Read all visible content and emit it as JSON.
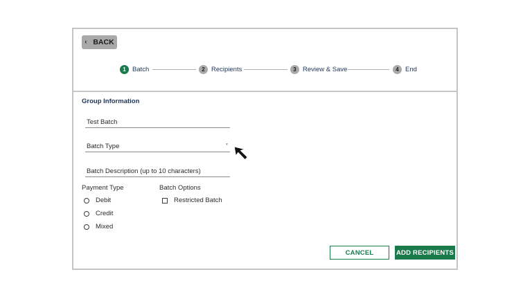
{
  "header": {
    "back_label": "BACK"
  },
  "steps": [
    {
      "num": "1",
      "label": "Batch",
      "active": true
    },
    {
      "num": "2",
      "label": "Recipients",
      "active": false
    },
    {
      "num": "3",
      "label": "Review & Save",
      "active": false
    },
    {
      "num": "4",
      "label": "End",
      "active": false
    }
  ],
  "form": {
    "section_title": "Group Information",
    "batch_name": "Test Batch",
    "batch_type": "Batch Type",
    "batch_description": "Batch Description (up to 10 characters)",
    "payment_type_label": "Payment Type",
    "payment_options": [
      "Debit",
      "Credit",
      "Mixed"
    ],
    "batch_options_label": "Batch Options",
    "restricted_batch_label": "Restricted Batch"
  },
  "actions": {
    "cancel_label": "CANCEL",
    "add_recipients_label": "ADD RECIPIENTS"
  },
  "colors": {
    "accent": "#1a7a4c",
    "step_inactive": "#a9a9a9",
    "heading": "#1f3556"
  },
  "icons": {
    "back": "chevron-left-icon",
    "cursor": "mouse-pointer-icon",
    "dropdown": "caret-down-icon"
  }
}
